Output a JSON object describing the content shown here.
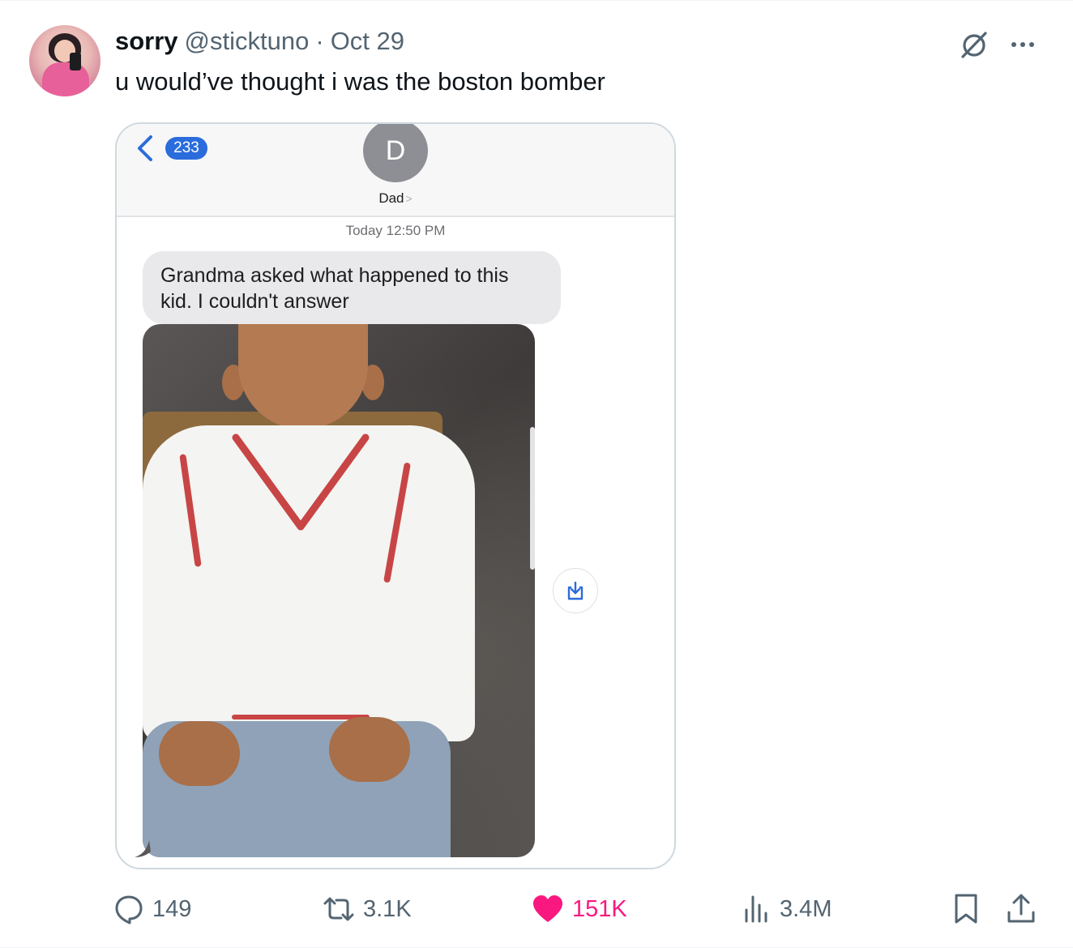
{
  "tweet": {
    "display_name": "sorry",
    "handle": "@sticktuno",
    "separator": "·",
    "date": "Oct 29",
    "text": "u would’ve thought i was the boston bomber"
  },
  "media": {
    "back_count": "233",
    "contact_initial": "D",
    "contact_name": "Dad",
    "contact_chevron": ">",
    "timestamp": "Today 12:50 PM",
    "message_text": "Grandma asked what happened to this kid.  I couldn't answer"
  },
  "actions": {
    "replies": "149",
    "retweets": "3.1K",
    "likes": "151K",
    "views": "3.4M"
  },
  "colors": {
    "like": "#f91880",
    "muted": "#536471",
    "ios_blue": "#2a6cdb",
    "bubble_gray": "#e9e9eb"
  },
  "icons": [
    "grok-icon",
    "more-icon",
    "back-chevron-icon",
    "download-icon",
    "reply-icon",
    "retweet-icon",
    "heart-icon",
    "views-icon",
    "bookmark-icon",
    "share-icon"
  ]
}
